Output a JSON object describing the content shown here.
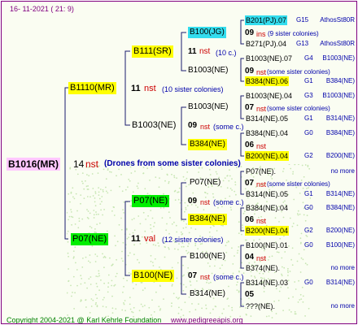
{
  "header": {
    "date": "16- 11-2021 ( 21: 9)"
  },
  "footer": {
    "copyright": "Copyright 2004-2021 @ Karl Kehrle Foundation",
    "site": "www.pedigreeapis.org"
  },
  "tree": {
    "root": {
      "label": "B1016(MR)",
      "count": "14",
      "unit": "nst",
      "note": "(Drones from some sister colonies)"
    },
    "g1": [
      {
        "label": "B1110(MR)",
        "count": "11",
        "unit": "nst",
        "note": "(10 sister colonies)"
      },
      {
        "label": "P07(NE)",
        "count": "11",
        "unit": "val",
        "note": "(12 sister colonies)"
      }
    ],
    "g2": [
      {
        "label": "B111(SR)",
        "count": "11",
        "unit": "nst",
        "note": "(10 c.)"
      },
      {
        "label": "B1003(NE)",
        "count": "09",
        "unit": "nst",
        "note": "(some c.)"
      },
      {
        "label": "P07(NE)",
        "count": "09",
        "unit": "nst",
        "note": "(some c.)"
      },
      {
        "label": "B100(NE)",
        "count": "07",
        "unit": "nst",
        "note": "(some c.)"
      }
    ],
    "g3": [
      {
        "label": "B100(JG)",
        "count": "09",
        "unit": "ins",
        "note": "(9 sister colonies)"
      },
      {
        "label": "B1003(NE)",
        "count": "09",
        "unit": "nst",
        "note": "(some sister colonies)"
      },
      {
        "label": "B1003(NE)",
        "count": "07",
        "unit": "nst",
        "note": "(some sister colonies)"
      },
      {
        "label": "B384(NE)",
        "count": "06",
        "unit": "nst",
        "note": ""
      },
      {
        "label": "P07(NE)",
        "count": "07",
        "unit": "nst",
        "note": "(some sister colonies)"
      },
      {
        "label": "B384(NE)",
        "count": "06",
        "unit": "nst",
        "note": ""
      },
      {
        "label": "B100(NE)",
        "count": "04",
        "unit": "nst",
        "note": ""
      },
      {
        "label": "B314(NE)",
        "count": "05",
        "unit": "",
        "note": ""
      }
    ],
    "g4": [
      {
        "label": "B201(PJ).07",
        "gen": "G15",
        "origin": "AthosSt80R"
      },
      {
        "label": "B271(PJ).04",
        "gen": "G13",
        "origin": "AthosSt80R"
      },
      {
        "label": "B1003(NE).07",
        "gen": "G4",
        "origin": "B1003(NE)"
      },
      {
        "label": "B384(NE).06",
        "gen": "G1",
        "origin": "B384(NE)"
      },
      {
        "label": "B1003(NE).04",
        "gen": "G3",
        "origin": "B1003(NE)"
      },
      {
        "label": "B314(NE).05",
        "gen": "G1",
        "origin": "B314(NE)"
      },
      {
        "label": "B384(NE).04",
        "gen": "G0",
        "origin": "B384(NE)"
      },
      {
        "label": "B200(NE).04",
        "gen": "G2",
        "origin": "B200(NE)"
      },
      {
        "label": "P07(NE).",
        "gen": "",
        "origin": "no more"
      },
      {
        "label": "B314(NE).05",
        "gen": "G1",
        "origin": "B314(NE)"
      },
      {
        "label": "B384(NE).04",
        "gen": "G0",
        "origin": "B384(NE)"
      },
      {
        "label": "B200(NE).04",
        "gen": "G2",
        "origin": "B200(NE)"
      },
      {
        "label": "B100(NE).01",
        "gen": "G0",
        "origin": "B100(NE)"
      },
      {
        "label": "B374(NE).",
        "gen": "",
        "origin": "no more"
      },
      {
        "label": "B314(NE).03",
        "gen": "G0",
        "origin": "B314(NE)"
      },
      {
        "label": "???(NE).",
        "gen": "",
        "origin": "no more"
      }
    ]
  },
  "colors": {
    "line": "#1a1a6e",
    "border": "#800080",
    "yellow": "#ffff00",
    "green": "#00ee00",
    "cyan": "#33ddee",
    "pink": "#ffc8ff"
  }
}
